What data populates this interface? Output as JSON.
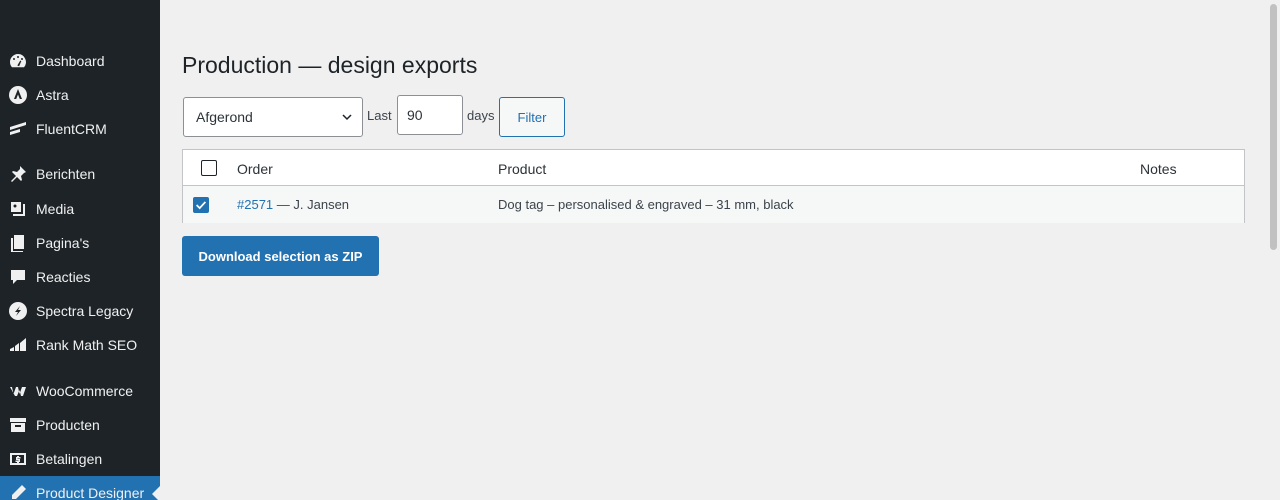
{
  "sidebar": {
    "items": [
      {
        "label": "Dashboard",
        "icon": "dashboard-icon"
      },
      {
        "label": "Astra",
        "icon": "astra-icon"
      },
      {
        "label": "FluentCRM",
        "icon": "fluentcrm-icon"
      },
      {
        "label": "Berichten",
        "icon": "pin-icon"
      },
      {
        "label": "Media",
        "icon": "media-icon"
      },
      {
        "label": "Pagina's",
        "icon": "pages-icon"
      },
      {
        "label": "Reacties",
        "icon": "comments-icon"
      },
      {
        "label": "Spectra Legacy",
        "icon": "spectra-icon"
      },
      {
        "label": "Rank Math SEO",
        "icon": "rankmath-icon"
      },
      {
        "label": "WooCommerce",
        "icon": "woocommerce-icon"
      },
      {
        "label": "Producten",
        "icon": "archive-icon"
      },
      {
        "label": "Betalingen",
        "icon": "payments-icon"
      },
      {
        "label": "Product Designer",
        "icon": "pencil-icon",
        "active": true
      }
    ]
  },
  "page": {
    "title": "Production — design exports"
  },
  "filters": {
    "status_selected": "Afgerond",
    "last_label": "Last",
    "days_value": "90",
    "days_label": "days",
    "filter_button": "Filter"
  },
  "table": {
    "headers": {
      "order": "Order",
      "product": "Product",
      "notes": "Notes"
    },
    "rows": [
      {
        "checked": true,
        "order_number": "#2571",
        "order_customer": " — J. Jansen",
        "product": "Dog tag – personalised & engraved – 31 mm, black",
        "notes": ""
      }
    ]
  },
  "actions": {
    "download_zip": "Download selection as ZIP"
  },
  "colors": {
    "sidebar_bg": "#1d2327",
    "accent": "#2271b1",
    "page_bg": "#f0f0f1"
  }
}
